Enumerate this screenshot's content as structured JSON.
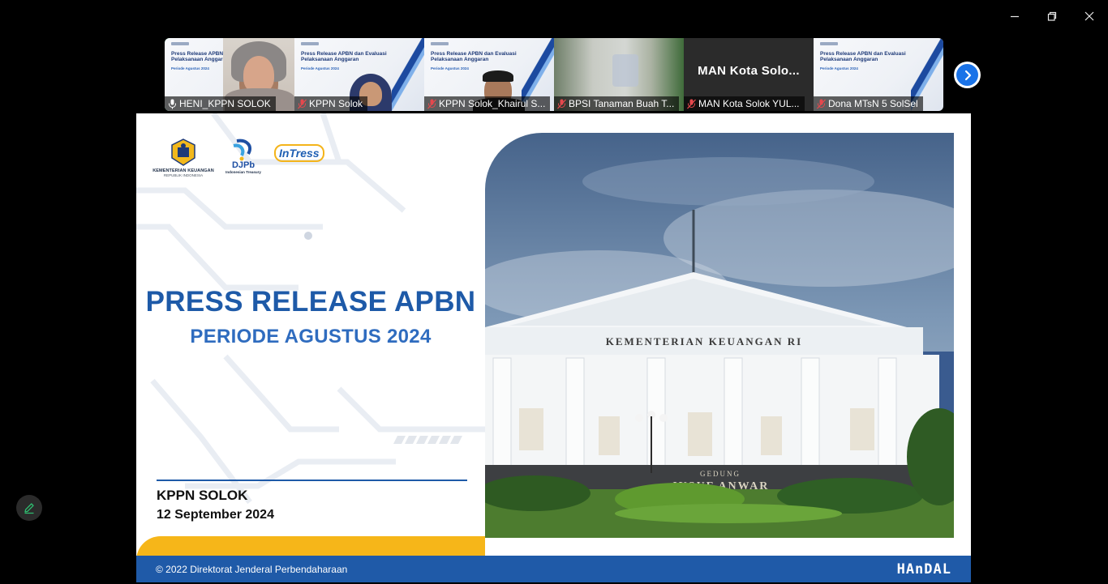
{
  "window_controls": {
    "minimize_icon": "minimize-icon",
    "restore_icon": "restore-icon",
    "close_icon": "close-icon"
  },
  "participants": [
    {
      "name": "HENI_KPPN SOLOK",
      "active": true,
      "mic": "mic-icon",
      "video": "slide-with-camera"
    },
    {
      "name": "KPPN Solok",
      "active": false,
      "mic": "mic-muted-icon",
      "video": "slide-with-camera"
    },
    {
      "name": "KPPN Solok_Khairul S...",
      "active": false,
      "mic": "mic-muted-icon",
      "video": "slide-with-camera"
    },
    {
      "name": "BPSI Tanaman Buah T...",
      "active": false,
      "mic": "mic-muted-icon",
      "video": "blurred-camera"
    },
    {
      "name": "MAN Kota Solok YUL...",
      "active": false,
      "mic": "mic-muted-icon",
      "video": "no-video",
      "display_name": "MAN  Kota Solo..."
    },
    {
      "name": "Dona MTsN 5 SolSel",
      "active": false,
      "mic": "mic-muted-icon",
      "video": "slide"
    }
  ],
  "thumbnail_slide": {
    "title": "Press Release APBN dan Evaluasi Pelaksanaan Anggaran",
    "period": "Periode Agustus 2024"
  },
  "next_icon": "chevron-right-icon",
  "slide": {
    "logo_kemenkeu_line1": "KEMENTERIAN KEUANGAN",
    "logo_kemenkeu_line2": "REPUBLIK INDONESIA",
    "logo_djpb": "DJPb",
    "logo_djpb_sub": "Indonesian Treasury",
    "logo_intress": "InTress",
    "title": "PRESS RELEASE APBN",
    "subtitle": "PERIODE AGUSTUS 2024",
    "org": "KPPN SOLOK",
    "date": "12 September 2024",
    "building_sign": "KEMENTERIAN KEUANGAN RI",
    "building_name_line1": "GEDUNG",
    "building_name_line2": "JUSUF ANWAR",
    "footer_copyright": "© 2022 Direktorat Jenderal Perbendaharaan",
    "footer_brand": "HAnDAL",
    "colors": {
      "primary": "#1e5aa8",
      "accent": "#f6b619"
    }
  },
  "annotate_icon": "pencil-icon"
}
